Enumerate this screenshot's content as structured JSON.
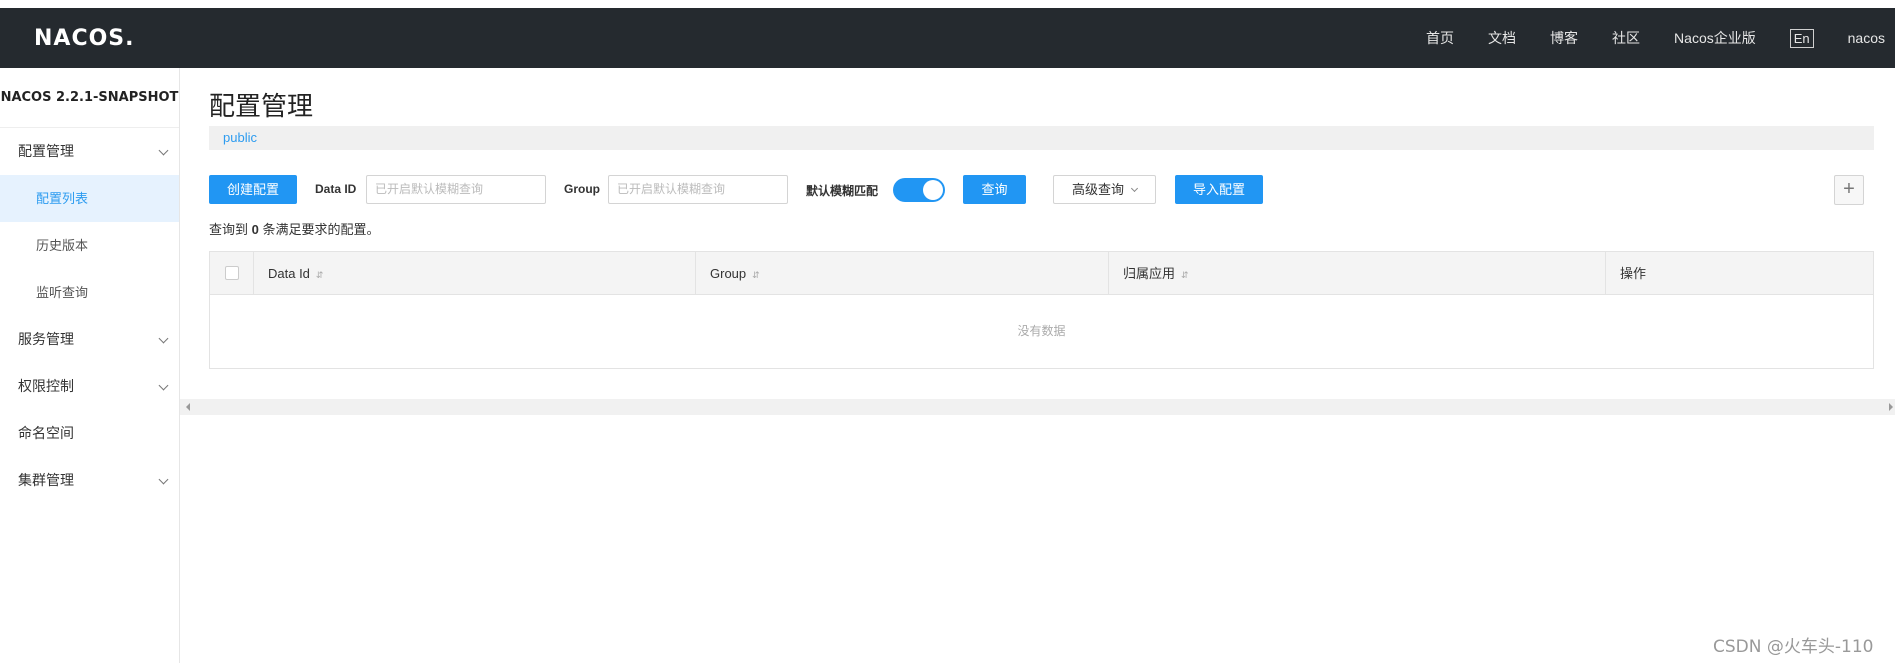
{
  "header": {
    "logo": "NACOS.",
    "nav": [
      "首页",
      "文档",
      "博客",
      "社区",
      "Nacos企业版"
    ],
    "lang": "En",
    "user": "nacos"
  },
  "sidebar": {
    "version": "NACOS 2.2.1-SNAPSHOT",
    "groups": [
      {
        "label": "配置管理",
        "expanded": true,
        "items": [
          "配置列表",
          "历史版本",
          "监听查询"
        ],
        "active_item": "配置列表"
      },
      {
        "label": "服务管理"
      },
      {
        "label": "权限控制"
      },
      {
        "label": "命名空间"
      },
      {
        "label": "集群管理"
      }
    ]
  },
  "main": {
    "title": "配置管理",
    "namespace": "public",
    "toolbar": {
      "create_label": "创建配置",
      "data_id_label": "Data ID",
      "data_id_placeholder": "已开启默认模糊查询",
      "group_label": "Group",
      "group_placeholder": "已开启默认模糊查询",
      "fuzzy_label": "默认模糊匹配",
      "fuzzy_enabled": true,
      "query_label": "查询",
      "advanced_label": "高级查询",
      "import_label": "导入配置",
      "add_icon": "plus-icon"
    },
    "result": {
      "prefix": "查询到",
      "count": "0",
      "suffix": "条满足要求的配置。"
    },
    "table": {
      "columns": [
        "Data Id",
        "Group",
        "归属应用",
        "操作"
      ],
      "empty_text": "没有数据"
    }
  },
  "watermark": "CSDN @火车头-110"
}
